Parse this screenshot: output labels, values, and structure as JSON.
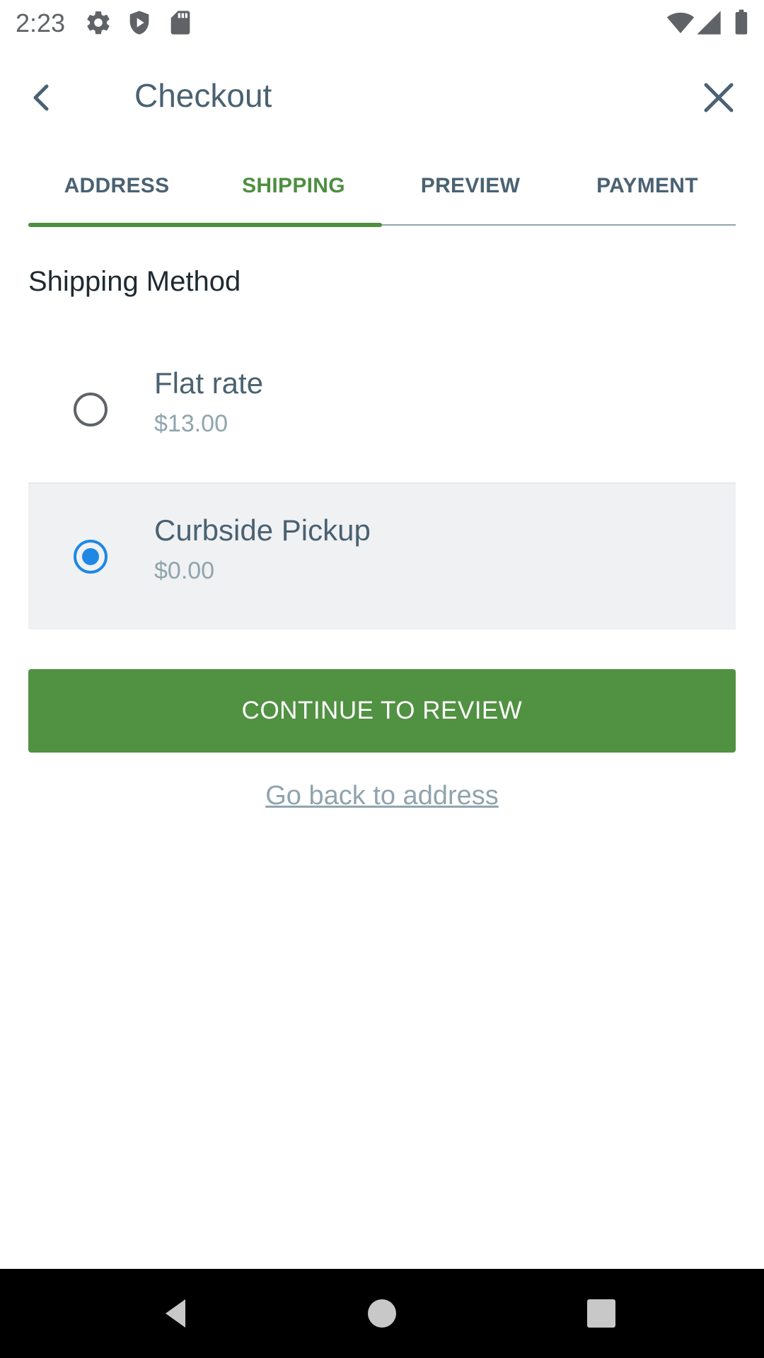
{
  "status_bar": {
    "time": "2:23",
    "icons": [
      "gear-icon",
      "shield-icon",
      "sd-card-icon",
      "wifi-icon",
      "signal-icon",
      "battery-icon"
    ]
  },
  "app_bar": {
    "title": "Checkout",
    "back_icon": "chevron-left-icon",
    "close_icon": "close-icon"
  },
  "tabs": [
    {
      "label": "ADDRESS",
      "active": false
    },
    {
      "label": "SHIPPING",
      "active": true
    },
    {
      "label": "PREVIEW",
      "active": false
    },
    {
      "label": "PAYMENT",
      "active": false
    }
  ],
  "progress": {
    "completed_steps": 2,
    "total_steps": 4
  },
  "shipping": {
    "title": "Shipping Method",
    "options": [
      {
        "name": "Flat rate",
        "price": "$13.00",
        "selected": false
      },
      {
        "name": "Curbside Pickup",
        "price": "$0.00",
        "selected": true
      }
    ]
  },
  "actions": {
    "continue_label": "CONTINUE TO REVIEW",
    "back_link": "Go back to address"
  },
  "colors": {
    "accent_green": "#519142",
    "active_tab": "#4e8e40",
    "radio_selected": "#1e88e5",
    "text_primary": "#4a6272",
    "text_secondary": "#90a4ae"
  },
  "nav_bar": {
    "icons": [
      "back-triangle-icon",
      "home-circle-icon",
      "recents-square-icon"
    ]
  }
}
